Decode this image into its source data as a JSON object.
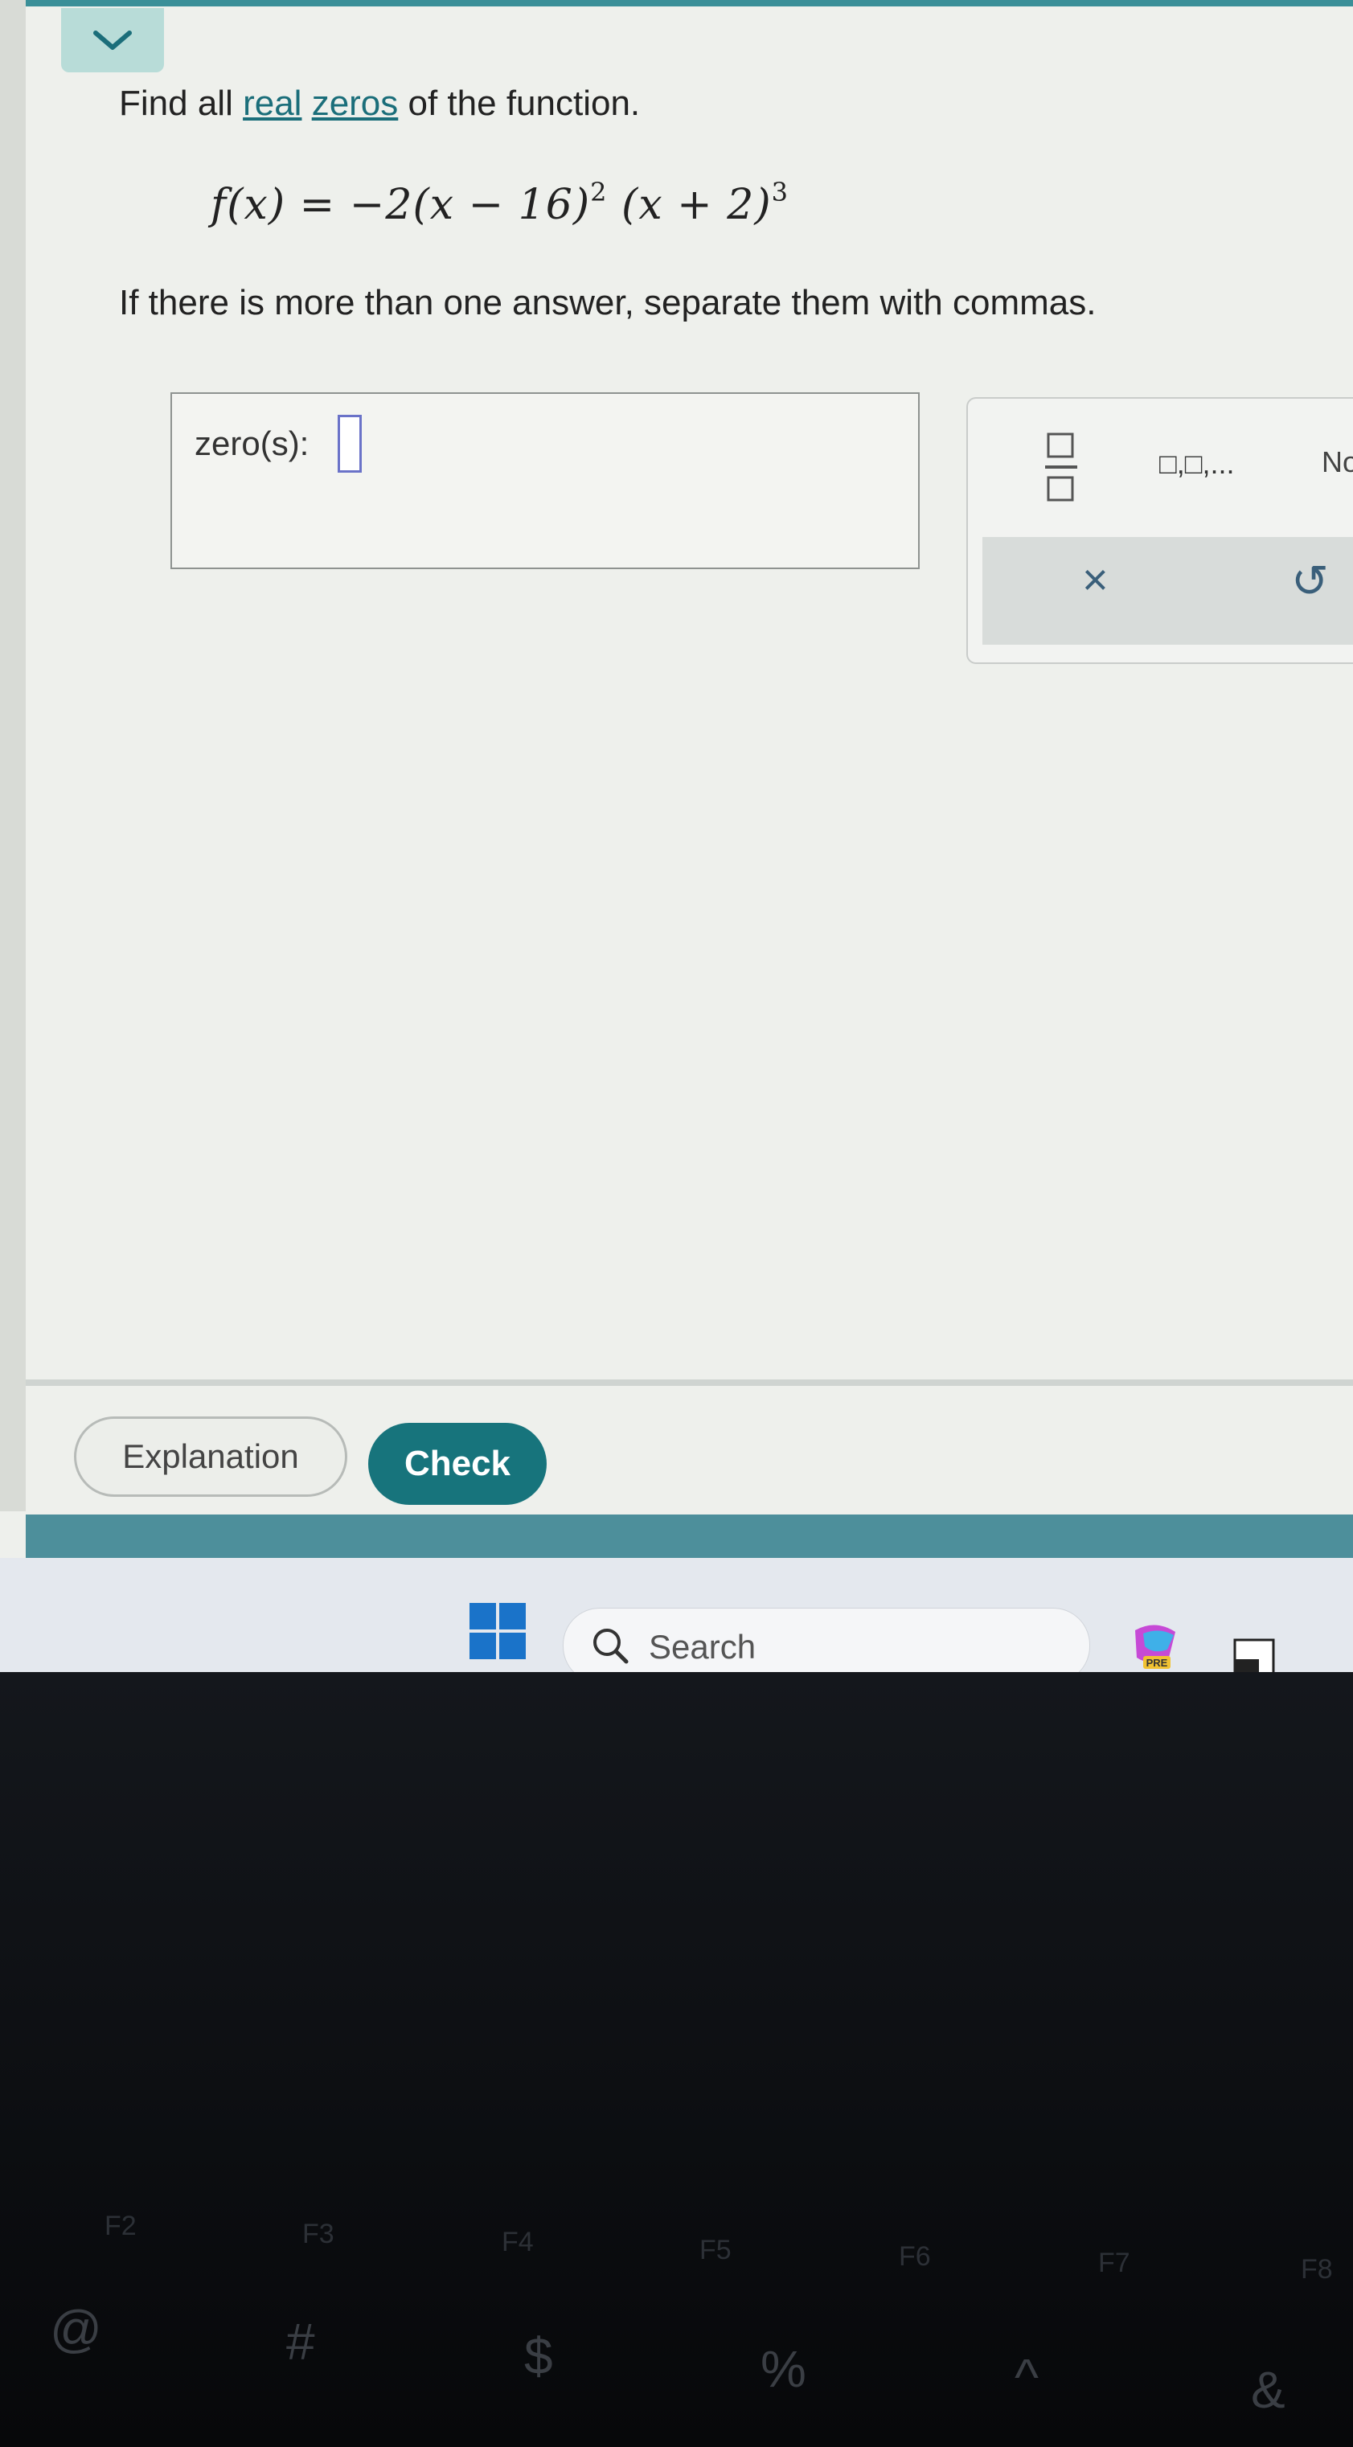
{
  "question": {
    "prefix": "Find all ",
    "link1": "real",
    "middle": " ",
    "link2": "zeros",
    "suffix": " of the function."
  },
  "formula": {
    "lhs": "f(x) = −2",
    "factor1": "(x − 16)",
    "exp1": "2",
    "factor2": "(x + 2)",
    "exp2": "3"
  },
  "instruction": "If there is more than one answer, separate them with commas.",
  "answer": {
    "label": "zero(s):",
    "value": ""
  },
  "keypad": {
    "list_key": "□,□,...",
    "none_key": "No",
    "clear_key": "×",
    "undo_key": "↺"
  },
  "buttons": {
    "explanation": "Explanation",
    "check": "Check"
  },
  "taskbar": {
    "search_placeholder": "Search",
    "copilot_badge": "PRE"
  },
  "keyboard": {
    "fkeys": [
      "F2",
      "F3",
      "F4",
      "F5",
      "F6",
      "F7",
      "F8"
    ],
    "numkeys": [
      "@",
      "#",
      "$",
      "%",
      "^",
      "&"
    ]
  },
  "colors": {
    "accent": "#17747c",
    "link": "#1b6e7a",
    "input_border": "#6a72c8"
  }
}
